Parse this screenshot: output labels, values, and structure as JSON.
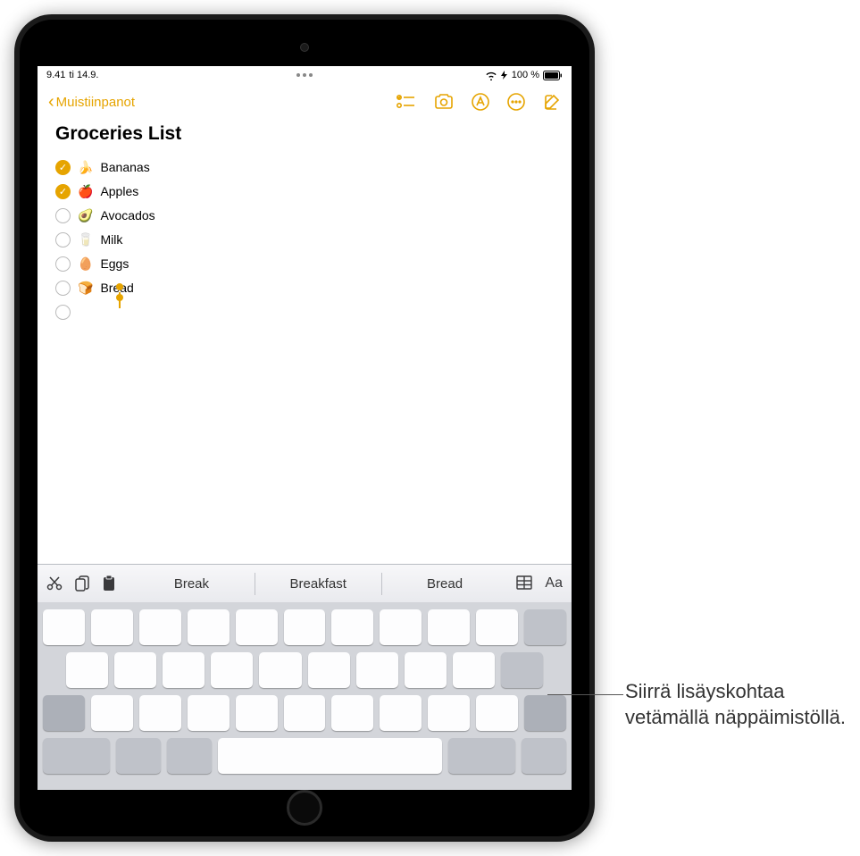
{
  "status": {
    "time": "9.41",
    "date": "ti 14.9.",
    "wifi": "wifi",
    "battery_pct": "100 %",
    "battery_icon": "battery-full"
  },
  "nav": {
    "back_label": "Muistiin­panot"
  },
  "note": {
    "title": "Groceries List",
    "items": [
      {
        "emoji": "🍌",
        "label": "Bananas",
        "checked": true
      },
      {
        "emoji": "🍎",
        "label": "Apples",
        "checked": true
      },
      {
        "emoji": "🥑",
        "label": "Avocados",
        "checked": false
      },
      {
        "emoji": "🥛",
        "label": "Milk",
        "checked": false
      },
      {
        "emoji": "🥚",
        "label": "Eggs",
        "checked": false
      },
      {
        "emoji": "🍞",
        "label": "Bread",
        "checked": false,
        "cursor": true
      },
      {
        "emoji": "",
        "label": "",
        "checked": false
      }
    ]
  },
  "keyboard": {
    "suggestions": [
      "Break",
      "Breakfast",
      "Bread"
    ],
    "format_label": "Aa"
  },
  "annotation": {
    "text": "Siirrä lisäyskohtaa vetämällä näppäimistöllä."
  },
  "colors": {
    "accent": "#e6a400"
  }
}
